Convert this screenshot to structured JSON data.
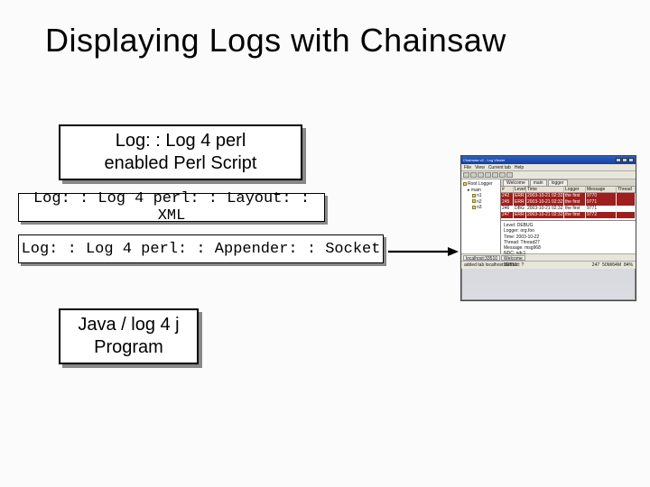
{
  "title": "Displaying Logs with Chainsaw",
  "boxes": {
    "perl_script": {
      "line1": "Log: : Log 4 perl",
      "line2": "enabled Perl Script"
    },
    "layout_xml": "Log: : Log 4 perl: : Layout: : XML",
    "appender_socket": "Log: : Log 4 perl: : Appender: : Socket",
    "java_prog": {
      "line1": "Java / log 4 j",
      "line2": "Program"
    }
  },
  "screenshot": {
    "window_title": "Chainsaw v2 - Log Viewer",
    "menu": [
      "File",
      "View",
      "Current tab",
      "Help"
    ],
    "tree": {
      "root": "Root Logger",
      "items": [
        "main",
        "n1",
        "n2",
        "n3"
      ]
    },
    "tabs": [
      "Welcome",
      "main",
      "logger"
    ],
    "table": {
      "headers": [
        "#",
        "Level",
        "Time",
        "Logger",
        "Message",
        "Thread"
      ],
      "rows": [
        {
          "n": "242",
          "level": "ERR",
          "time": "2003-10-21 02:32:0...",
          "logger": "the first",
          "msg": "9770",
          "thread": ""
        },
        {
          "n": "245",
          "level": "ERR",
          "time": "2003-10-21 02:32:0...",
          "logger": "the first",
          "msg": "9771",
          "thread": ""
        },
        {
          "n": "246",
          "level": "DBG",
          "time": "2003-10-21 02:32:0...",
          "logger": "the first",
          "msg": "9771",
          "thread": ""
        },
        {
          "n": "247",
          "level": "ERR",
          "time": "2003-10-21 02:32:0...",
          "logger": "the first",
          "msg": "9772",
          "thread": ""
        }
      ]
    },
    "detail": {
      "Level": "DEBUG",
      "LoggerName": "org.foo",
      "Time": "2003-10-22",
      "Thread": "Thread27",
      "Message": "msg968",
      "NDC": "ndc1",
      "Class": "",
      "Method": "?",
      "Line": "?"
    },
    "status_tabs": [
      "localhost:33510",
      "Welcome"
    ],
    "footer_left": "added tab localhost:33510",
    "footer_right": {
      "count": "247",
      "mem": "50M/64M",
      "pct": "84%"
    }
  }
}
